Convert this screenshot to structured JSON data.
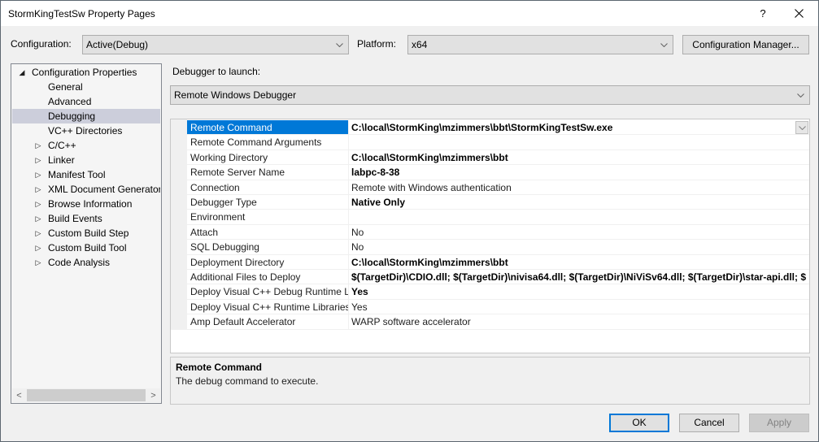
{
  "window": {
    "title": "StormKingTestSw Property Pages",
    "help_label": "?",
    "close_label": "×"
  },
  "config_bar": {
    "configuration_label": "Configuration:",
    "configuration_value": "Active(Debug)",
    "platform_label": "Platform:",
    "platform_value": "x64",
    "config_manager_label": "Configuration Manager..."
  },
  "tree": {
    "root": {
      "label": "Configuration Properties",
      "expanded": true
    },
    "items": [
      {
        "label": "General",
        "expandable": false,
        "selected": false
      },
      {
        "label": "Advanced",
        "expandable": false,
        "selected": false
      },
      {
        "label": "Debugging",
        "expandable": false,
        "selected": true
      },
      {
        "label": "VC++ Directories",
        "expandable": false,
        "selected": false
      },
      {
        "label": "C/C++",
        "expandable": true,
        "selected": false
      },
      {
        "label": "Linker",
        "expandable": true,
        "selected": false
      },
      {
        "label": "Manifest Tool",
        "expandable": true,
        "selected": false
      },
      {
        "label": "XML Document Generator",
        "expandable": true,
        "selected": false
      },
      {
        "label": "Browse Information",
        "expandable": true,
        "selected": false
      },
      {
        "label": "Build Events",
        "expandable": true,
        "selected": false
      },
      {
        "label": "Custom Build Step",
        "expandable": true,
        "selected": false
      },
      {
        "label": "Custom Build Tool",
        "expandable": true,
        "selected": false
      },
      {
        "label": "Code Analysis",
        "expandable": true,
        "selected": false
      }
    ],
    "scroll_left": "<",
    "scroll_right": ">"
  },
  "debugger": {
    "label": "Debugger to launch:",
    "value": "Remote Windows Debugger"
  },
  "properties": [
    {
      "name": "Remote Command",
      "value": "C:\\local\\StormKing\\mzimmers\\bbt\\StormKingTestSw.exe",
      "bold": true,
      "selected": true
    },
    {
      "name": "Remote Command Arguments",
      "value": "",
      "bold": false,
      "selected": false
    },
    {
      "name": "Working Directory",
      "value": "C:\\local\\StormKing\\mzimmers\\bbt",
      "bold": true,
      "selected": false
    },
    {
      "name": "Remote Server Name",
      "value": "labpc-8-38",
      "bold": true,
      "selected": false
    },
    {
      "name": "Connection",
      "value": "Remote with Windows authentication",
      "bold": false,
      "selected": false
    },
    {
      "name": "Debugger Type",
      "value": "Native Only",
      "bold": true,
      "selected": false
    },
    {
      "name": "Environment",
      "value": "",
      "bold": false,
      "selected": false
    },
    {
      "name": "Attach",
      "value": "No",
      "bold": false,
      "selected": false
    },
    {
      "name": "SQL Debugging",
      "value": "No",
      "bold": false,
      "selected": false
    },
    {
      "name": "Deployment Directory",
      "value": "C:\\local\\StormKing\\mzimmers\\bbt",
      "bold": true,
      "selected": false
    },
    {
      "name": "Additional Files to Deploy",
      "value": "$(TargetDir)\\CDIO.dll; $(TargetDir)\\nivisa64.dll; $(TargetDir)\\NiViSv64.dll; $(TargetDir)\\star-api.dll; $",
      "bold": true,
      "selected": false
    },
    {
      "name": "Deploy Visual C++ Debug Runtime L",
      "value": "Yes",
      "bold": true,
      "selected": false
    },
    {
      "name": "Deploy Visual C++ Runtime Libraries",
      "value": "Yes",
      "bold": false,
      "selected": false
    },
    {
      "name": "Amp Default Accelerator",
      "value": "WARP software accelerator",
      "bold": false,
      "selected": false
    }
  ],
  "description": {
    "title": "Remote Command",
    "text": "The debug command to execute."
  },
  "buttons": {
    "ok": "OK",
    "cancel": "Cancel",
    "apply": "Apply"
  },
  "colors": {
    "selection_accent": "#0078d7",
    "tree_selection": "#cccedb"
  }
}
